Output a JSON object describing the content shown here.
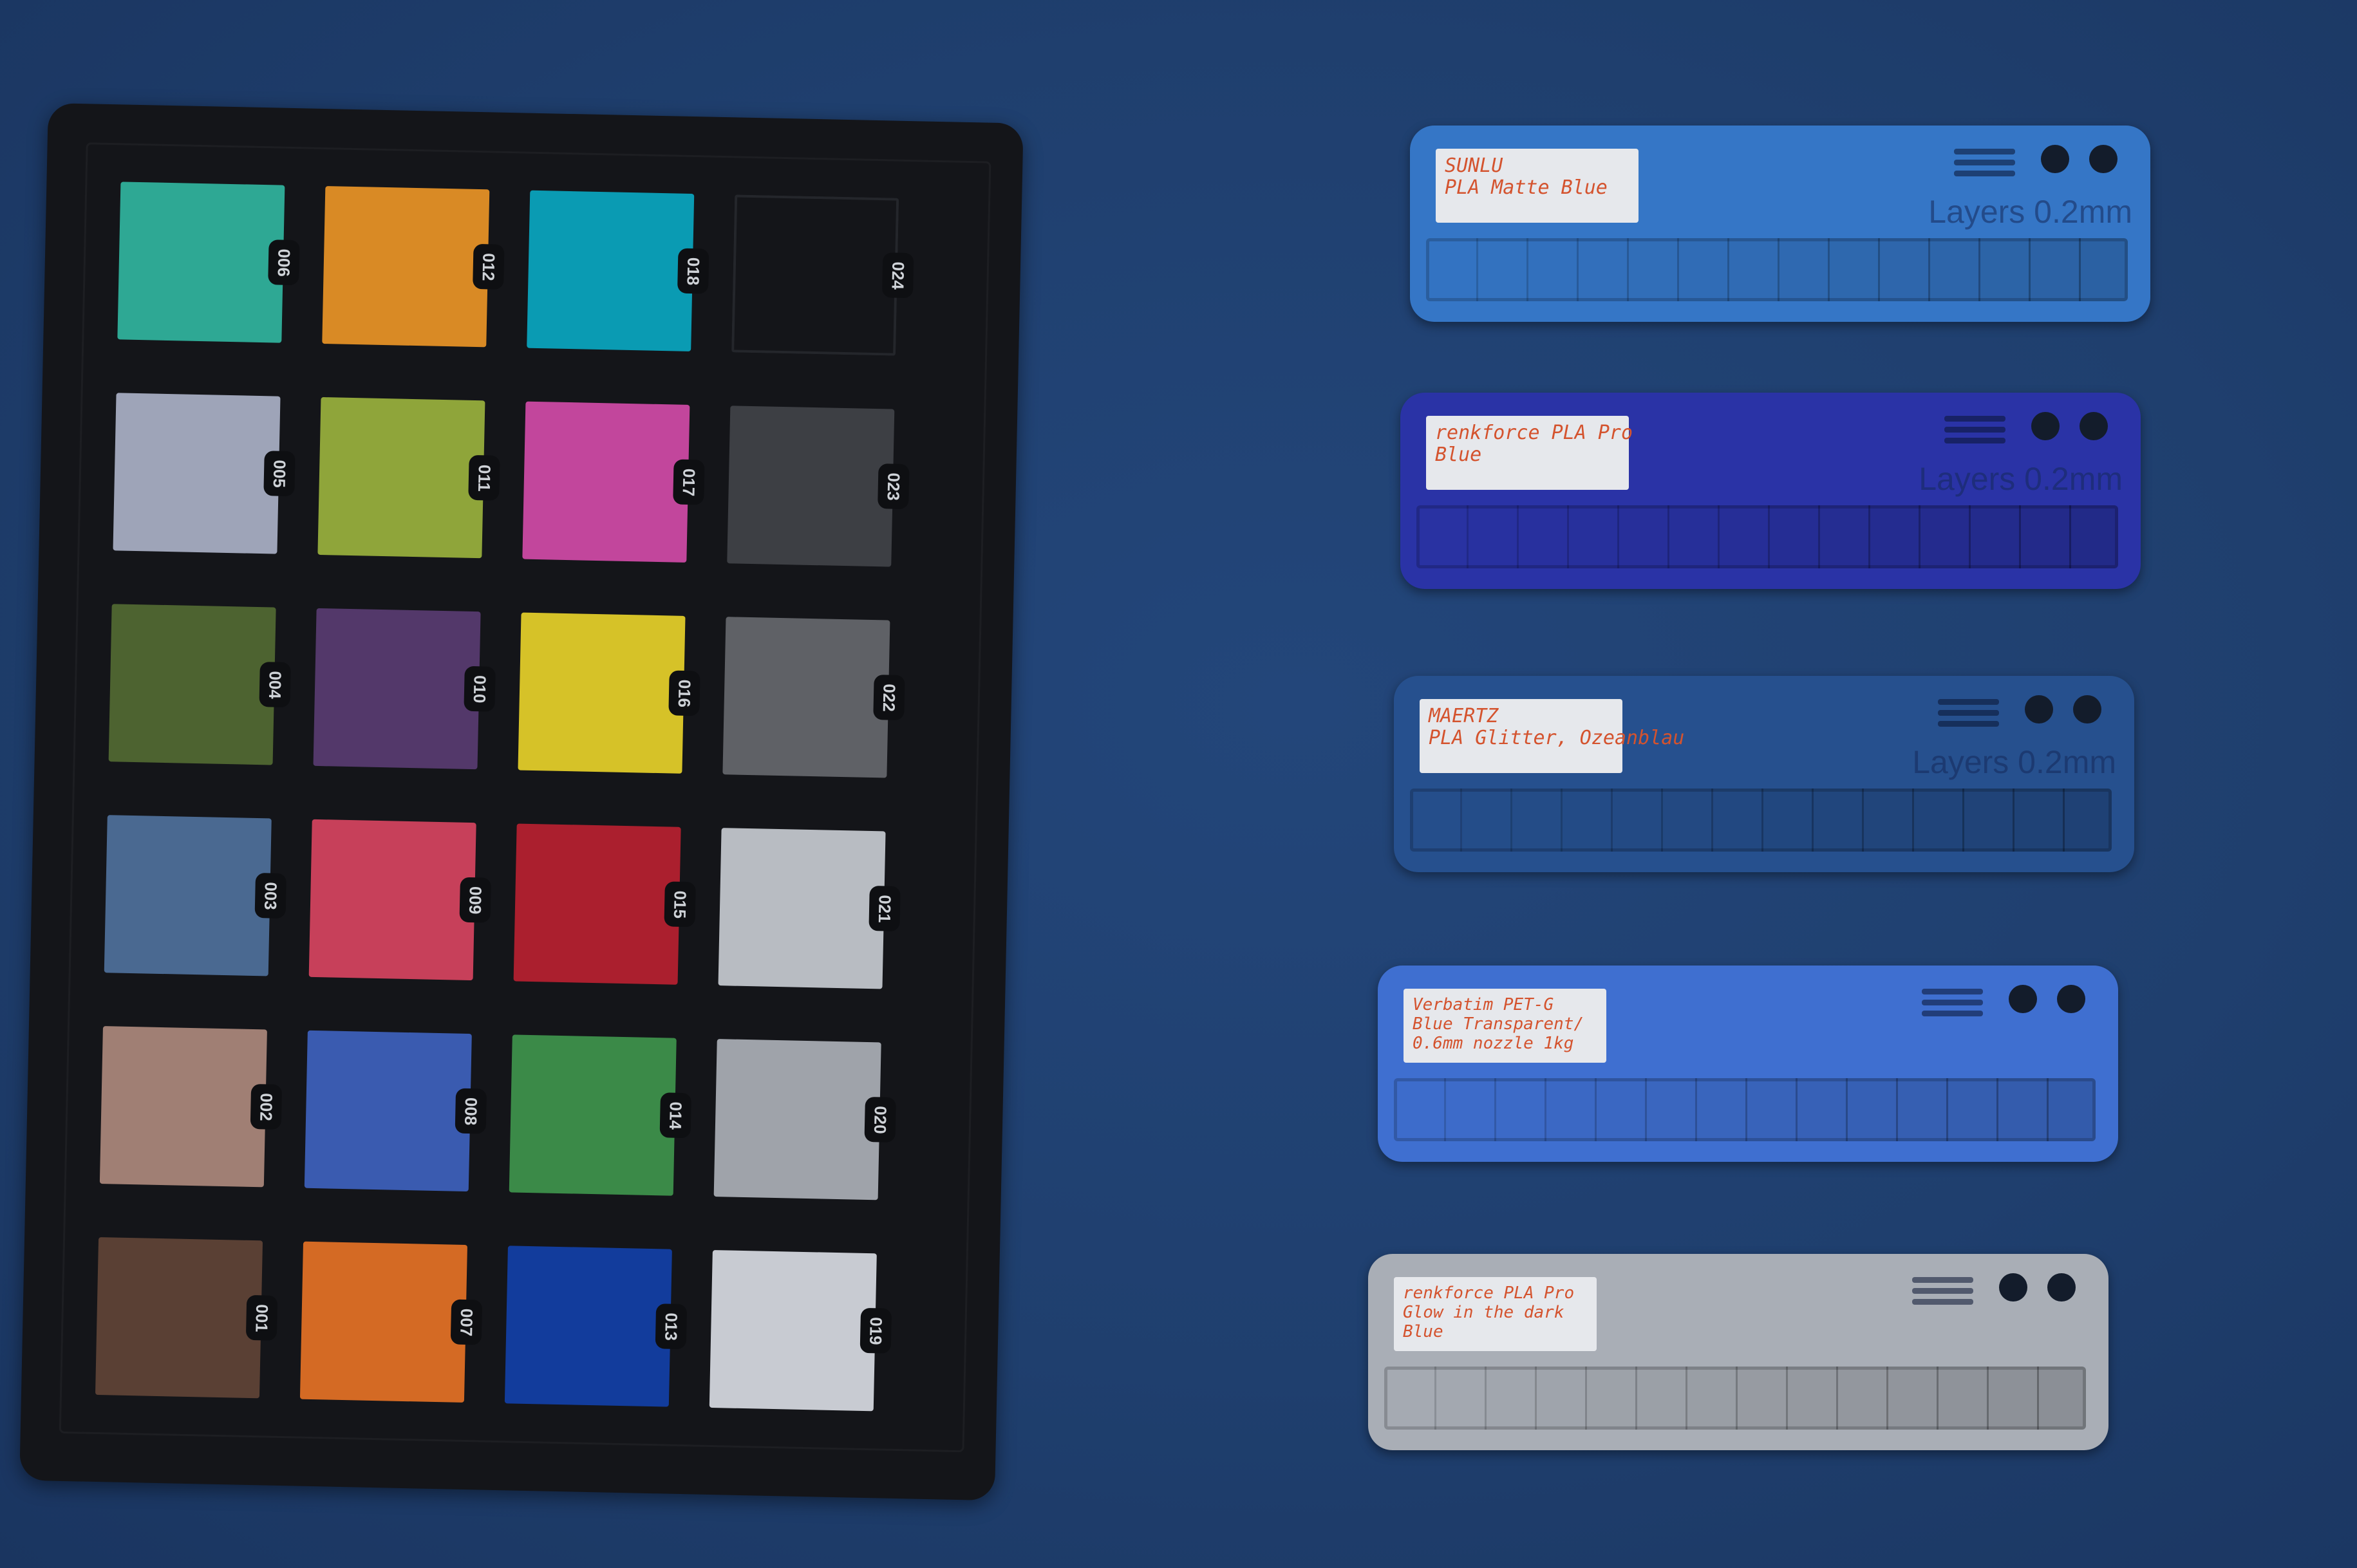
{
  "scene": {
    "background_color": "#20406a"
  },
  "color_checker": {
    "patches": [
      {
        "label": "006",
        "color": "#2ea894"
      },
      {
        "label": "012",
        "color": "#d98a25"
      },
      {
        "label": "018",
        "color": "#0a9bb3"
      },
      {
        "label": "024",
        "color": "#141519"
      },
      {
        "label": "005",
        "color": "#9ea4b8"
      },
      {
        "label": "011",
        "color": "#8fa53a"
      },
      {
        "label": "017",
        "color": "#c2469c"
      },
      {
        "label": "023",
        "color": "#3d3f44"
      },
      {
        "label": "004",
        "color": "#4d6330"
      },
      {
        "label": "010",
        "color": "#53386a"
      },
      {
        "label": "016",
        "color": "#d6c228"
      },
      {
        "label": "022",
        "color": "#5f6166"
      },
      {
        "label": "003",
        "color": "#4a6991"
      },
      {
        "label": "009",
        "color": "#c7405a"
      },
      {
        "label": "015",
        "color": "#ab1f2e"
      },
      {
        "label": "021",
        "color": "#b8bcc2"
      },
      {
        "label": "002",
        "color": "#a07f74"
      },
      {
        "label": "008",
        "color": "#3a5bb0"
      },
      {
        "label": "014",
        "color": "#3b8a48"
      },
      {
        "label": "020",
        "color": "#9fa3aa"
      },
      {
        "label": "001",
        "color": "#5a4034"
      },
      {
        "label": "007",
        "color": "#d46a24"
      },
      {
        "label": "013",
        "color": "#123c9c"
      },
      {
        "label": "019",
        "color": "#c8cbd2"
      }
    ]
  },
  "samples": [
    {
      "name": "sunlu-matte-blue",
      "color": "#3576c6",
      "text_lines": [
        "SUNLU",
        "PLA Matte Blue"
      ],
      "layers_text": "Layers 0.2mm"
    },
    {
      "name": "renkforce-pla-pro-blue",
      "color": "#2a33a6",
      "text_lines": [
        "renkforce PLA Pro",
        "Blue"
      ],
      "layers_text": "Layers 0.2mm"
    },
    {
      "name": "maertz-glitter",
      "color": "#26508e",
      "text_lines": [
        "MAERTZ",
        "PLA Glitter, Ozeanblau"
      ],
      "layers_text": "Layers 0.2mm"
    },
    {
      "name": "verbatim-petg",
      "color": "#3f6fd0",
      "text_lines": [
        "Verbatim PET-G",
        "Blue Transparent/",
        "0.6mm nozzle 1kg"
      ],
      "layers_text": ""
    },
    {
      "name": "renkforce-glow",
      "color": "#a9aeb6",
      "text_lines": [
        "renkforce PLA Pro",
        "Glow in the dark",
        "Blue"
      ],
      "layers_text": ""
    }
  ]
}
